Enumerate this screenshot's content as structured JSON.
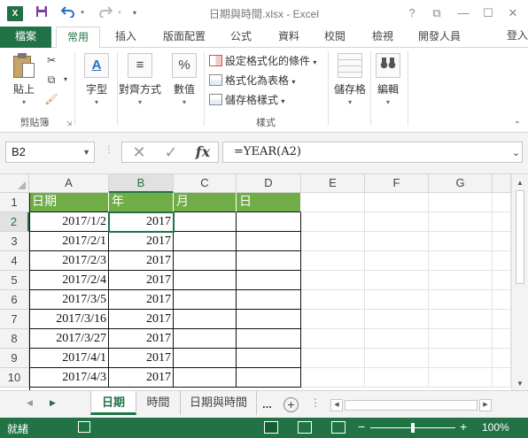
{
  "window": {
    "title": "日期與時間.xlsx - Excel",
    "app_icon": "X",
    "help": "?",
    "controls": {
      "restore": "⧉",
      "minimize": "—",
      "maximize": "☐",
      "close": "✕"
    },
    "quick_access": {
      "save_icon": "save-icon",
      "undo_icon": "undo-icon",
      "redo_icon": "redo-icon"
    }
  },
  "tabs": {
    "file": "檔案",
    "items": [
      "常用",
      "插入",
      "版面配置",
      "公式",
      "資料",
      "校閱",
      "檢視",
      "開發人員"
    ],
    "active": "常用",
    "login": "登入"
  },
  "ribbon": {
    "clipboard": {
      "paste": "貼上",
      "label": "剪貼簿"
    },
    "font": {
      "label": "字型"
    },
    "alignment": {
      "label": "對齊方式"
    },
    "number": {
      "label": "數值"
    },
    "styles": {
      "label": "樣式",
      "conditional": "設定格式化的條件",
      "as_table": "格式化為表格",
      "cell_styles": "儲存格樣式"
    },
    "cells": {
      "label": "儲存格"
    },
    "editing": {
      "label": "編輯"
    },
    "icons": {
      "font_glyph": "A",
      "number_glyph": "%",
      "align_glyph": "≡"
    }
  },
  "formula_bar": {
    "name_box": "B2",
    "formula": "=YEAR(A2)",
    "cancel_glyph": "✕",
    "enter_glyph": "✓",
    "fx_glyph": "fx"
  },
  "grid": {
    "columns": [
      "A",
      "B",
      "C",
      "D",
      "E",
      "F",
      "G"
    ],
    "selected_column": "B",
    "rows": [
      "1",
      "2",
      "3",
      "4",
      "5",
      "6",
      "7",
      "8",
      "9",
      "10"
    ],
    "selected_row": "2",
    "header_row": [
      "日期",
      "年",
      "月",
      "日"
    ],
    "data": [
      [
        "2017/1/2",
        "2017"
      ],
      [
        "2017/2/1",
        "2017"
      ],
      [
        "2017/2/3",
        "2017"
      ],
      [
        "2017/2/4",
        "2017"
      ],
      [
        "2017/3/5",
        "2017"
      ],
      [
        "2017/3/16",
        "2017"
      ],
      [
        "2017/3/27",
        "2017"
      ],
      [
        "2017/4/1",
        "2017"
      ],
      [
        "2017/4/3",
        "2017"
      ]
    ],
    "header_fill": "#70ad47",
    "accent": "#217346"
  },
  "sheets": {
    "tabs": [
      "日期",
      "時間",
      "日期與時間"
    ],
    "active": "日期",
    "more": "...",
    "add": "+"
  },
  "status": {
    "ready": "就緒",
    "zoom": "100%",
    "zoom_minus": "−",
    "zoom_plus": "+"
  }
}
